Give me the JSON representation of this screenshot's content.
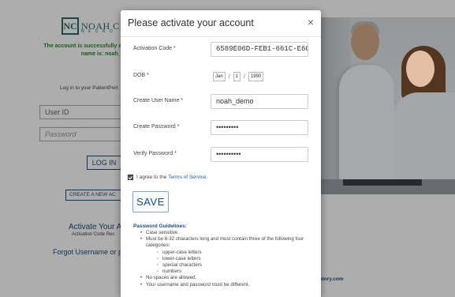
{
  "background": {
    "logo_mark": "NC",
    "logo_name": "NOAH CLI",
    "logo_sub": "N E U R O",
    "success_line1": "The account is successfully ac",
    "success_line2": "name is: noah_d",
    "login_to": "Log in to your PatientPort",
    "user_id_placeholder": "User ID",
    "password_placeholder": "Password",
    "login_button": "LOG IN",
    "create_account_button": "CREATE A NEW AC",
    "activate_title": "Activate Your Ac",
    "activate_sub": "Activation Code Rec",
    "forgot": "Forgot Username or p",
    "footer_link": "atory.com"
  },
  "modal": {
    "title": "Please activate your account",
    "close": "×",
    "activation_code_label": "Activation Code *",
    "activation_code_value": "6589E06D-FEB1-661C-E6C",
    "dob_label": "DOB *",
    "dob_month": "Jan",
    "dob_day": "1",
    "dob_year": "1990",
    "username_label": "Create User Name *",
    "username_value": "noah_demo",
    "password_label": "Create Password *",
    "password_value": "•••••••••",
    "verify_label": "Verify Password *",
    "verify_value": "••••••••••",
    "agree_text": "I agree to the",
    "terms_link": "Terms of Service.",
    "save_button": "SAVE",
    "guidelines_title": "Password Guidelines:",
    "guidelines": [
      "Case sensitive.",
      "Must be 8-32 characters long and must contain three of the following four categories:",
      "No spaces are allowed.",
      "Your username and password must be different."
    ],
    "categories": [
      "upper-case letters",
      "lower-case letters",
      "special characters",
      "numbers"
    ]
  }
}
